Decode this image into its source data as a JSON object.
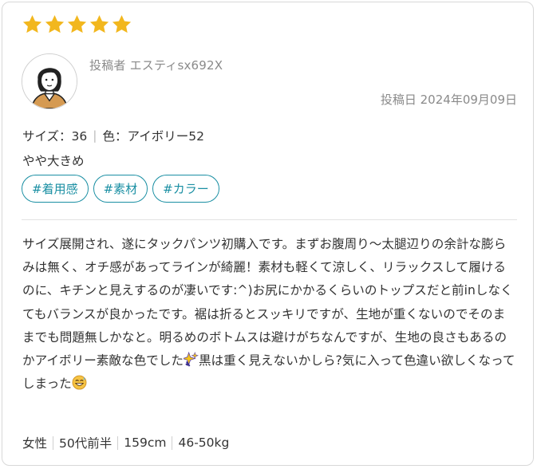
{
  "rating": {
    "stars": 5,
    "max": 5,
    "color": "#f2b71e"
  },
  "poster": {
    "label": "投稿者 エスティsx692X"
  },
  "posted": {
    "label": "投稿日 2024年09月09日"
  },
  "meta": {
    "size": "サイズ：36",
    "color": "色：アイボリー52"
  },
  "fit": "やや大きめ",
  "tags": [
    "#着用感",
    "#素材",
    "#カラー"
  ],
  "review": {
    "part1": "サイズ展開され、遂にタックパンツ初購入です。まずお腹周り〜太腿辺りの余計な膨らみは無く、オチ感があってラインが綺麗！素材も軽くて涼しく、リラックスして履けるのに、キチンと見えするのが凄いです:^)お尻にかかるくらいのトップスだと前inしなくてもバランスが良かったです。裾は折るとスッキリですが、生地が重くないのでそのままでも問題無しかなと。明るめのボトムスは避けがちなんですが、生地の良さもあるのかアイボリー素敵な色でした",
    "part2": "黒は重く見えないかしら?気に入って色違い欲しくなってしまった",
    "emoji1": "sparkles-icon",
    "emoji2": "sweat-smile-icon"
  },
  "profile": {
    "gender": "女性",
    "age": "50代前半",
    "height": "159cm",
    "weight": "46-50kg"
  },
  "accent": "#1a8fa3"
}
